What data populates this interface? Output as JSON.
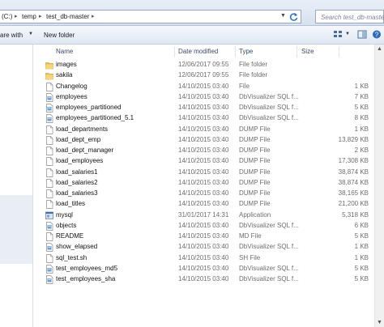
{
  "address": {
    "crumbs": [
      "(C:)",
      "temp",
      "test_db-master"
    ],
    "search_placeholder": "Search test_db-master"
  },
  "toolbar": {
    "share_label": "are with",
    "new_folder_label": "New folder"
  },
  "columns": {
    "name": "Name",
    "date": "Date modified",
    "type": "Type",
    "size": "Size"
  },
  "files": [
    {
      "name": "images",
      "date": "12/06/2017 09:55",
      "type": "File folder",
      "size": "",
      "icon": "folder-icon"
    },
    {
      "name": "sakila",
      "date": "12/06/2017 09:55",
      "type": "File folder",
      "size": "",
      "icon": "folder-icon"
    },
    {
      "name": "Changelog",
      "date": "14/10/2015 03:40",
      "type": "File",
      "size": "1 KB",
      "icon": "file-icon"
    },
    {
      "name": "employees",
      "date": "14/10/2015 03:40",
      "type": "DbVisualizer SQL f...",
      "size": "7 KB",
      "icon": "sql-file-icon"
    },
    {
      "name": "employees_partitioned",
      "date": "14/10/2015 03:40",
      "type": "DbVisualizer SQL f...",
      "size": "5 KB",
      "icon": "sql-file-icon"
    },
    {
      "name": "employees_partitioned_5.1",
      "date": "14/10/2015 03:40",
      "type": "DbVisualizer SQL f...",
      "size": "8 KB",
      "icon": "sql-file-icon"
    },
    {
      "name": "load_departments",
      "date": "14/10/2015 03:40",
      "type": "DUMP File",
      "size": "1 KB",
      "icon": "file-icon"
    },
    {
      "name": "load_dept_emp",
      "date": "14/10/2015 03:40",
      "type": "DUMP File",
      "size": "13,829 KB",
      "icon": "file-icon"
    },
    {
      "name": "load_dept_manager",
      "date": "14/10/2015 03:40",
      "type": "DUMP File",
      "size": "2 KB",
      "icon": "file-icon"
    },
    {
      "name": "load_employees",
      "date": "14/10/2015 03:40",
      "type": "DUMP File",
      "size": "17,308 KB",
      "icon": "file-icon"
    },
    {
      "name": "load_salaries1",
      "date": "14/10/2015 03:40",
      "type": "DUMP File",
      "size": "38,874 KB",
      "icon": "file-icon"
    },
    {
      "name": "load_salaries2",
      "date": "14/10/2015 03:40",
      "type": "DUMP File",
      "size": "38,874 KB",
      "icon": "file-icon"
    },
    {
      "name": "load_salaries3",
      "date": "14/10/2015 03:40",
      "type": "DUMP File",
      "size": "38,165 KB",
      "icon": "file-icon"
    },
    {
      "name": "load_titles",
      "date": "14/10/2015 03:40",
      "type": "DUMP File",
      "size": "21,200 KB",
      "icon": "file-icon"
    },
    {
      "name": "mysql",
      "date": "31/01/2017 14:31",
      "type": "Application",
      "size": "5,318 KB",
      "icon": "app-icon"
    },
    {
      "name": "objects",
      "date": "14/10/2015 03:40",
      "type": "DbVisualizer SQL f...",
      "size": "6 KB",
      "icon": "sql-file-icon"
    },
    {
      "name": "README",
      "date": "14/10/2015 03:40",
      "type": "MD File",
      "size": "5 KB",
      "icon": "file-icon"
    },
    {
      "name": "show_elapsed",
      "date": "14/10/2015 03:40",
      "type": "DbVisualizer SQL f...",
      "size": "1 KB",
      "icon": "sql-file-icon"
    },
    {
      "name": "sql_test.sh",
      "date": "14/10/2015 03:40",
      "type": "SH File",
      "size": "1 KB",
      "icon": "file-icon"
    },
    {
      "name": "test_employees_md5",
      "date": "14/10/2015 03:40",
      "type": "DbVisualizer SQL f...",
      "size": "5 KB",
      "icon": "sql-file-icon"
    },
    {
      "name": "test_employees_sha",
      "date": "14/10/2015 03:40",
      "type": "DbVisualizer SQL f...",
      "size": "5 KB",
      "icon": "sql-file-icon"
    }
  ]
}
